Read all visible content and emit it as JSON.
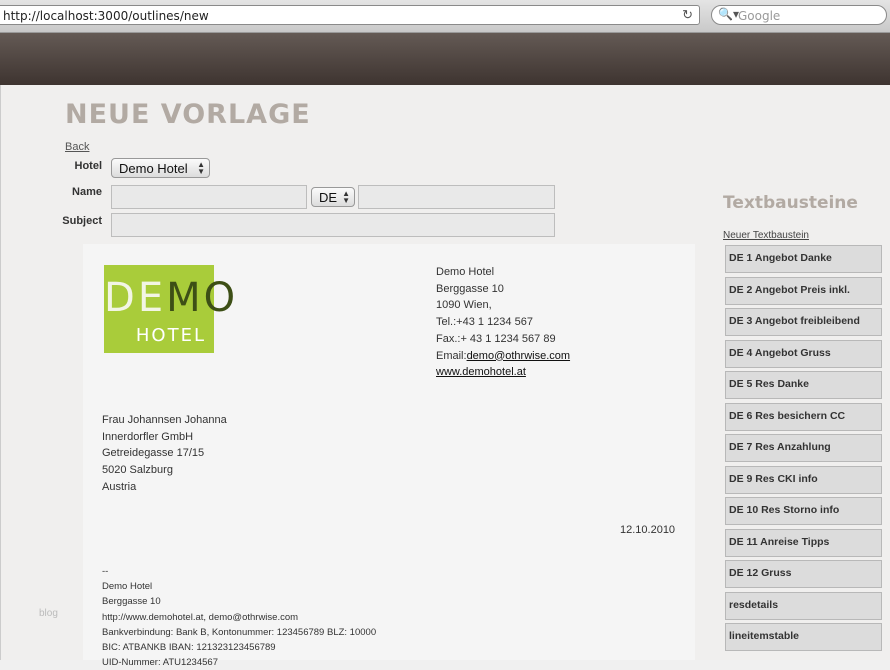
{
  "browser": {
    "url": "http://localhost:3000/outlines/new",
    "search_placeholder": "Google",
    "reload_glyph": "↻",
    "search_glyph": "🔍▾"
  },
  "page": {
    "title": "NEUE VORLAGE",
    "back": "Back"
  },
  "form": {
    "hotel_label": "Hotel",
    "hotel_value": "Demo Hotel",
    "name_label": "Name",
    "language_value": "DE",
    "subject_label": "Subject",
    "name_value": "",
    "name_suffix_value": "",
    "subject_value": ""
  },
  "letter": {
    "logo": {
      "demo_text": "DEMO",
      "hotel_text": "HOTEL"
    },
    "sender": {
      "name": "Demo Hotel",
      "street": "Berggasse 10",
      "city": "1090 Wien,",
      "tel": "Tel.:+43 1 1234 567",
      "fax": "Fax.:+ 43 1 1234 567 89",
      "email_prefix": "Email:",
      "email": "demo@othrwise.com",
      "web": "www.demohotel.at"
    },
    "recipient": [
      "Frau Johannsen Johanna",
      "Innerdorfler GmbH",
      "Getreidegasse 17/15",
      "5020 Salzburg",
      "Austria"
    ],
    "date": "12.10.2010",
    "signature": [
      "--",
      "Demo Hotel",
      "Berggasse 10",
      "http://www.demohotel.at, demo@othrwise.com",
      "Bankverbindung: Bank B, Kontonummer: 123456789 BLZ: 10000",
      "BIC: ATBANKB IBAN: 121323123456789",
      "UID-Nummer: ATU1234567"
    ]
  },
  "footer": {
    "blog": "blog"
  },
  "sidebar": {
    "title": "Textbausteine",
    "new_link": "Neuer Textbaustein",
    "items": [
      "DE 1 Angebot Danke",
      "DE 2 Angebot Preis inkl.",
      "DE 3 Angebot freibleibend",
      "DE 4 Angebot Gruss",
      "DE 5 Res Danke",
      "DE 6 Res besichern CC",
      "DE 7 Res Anzahlung",
      "DE 9 Res CKI info",
      "DE 10 Res Storno info",
      "DE 11 Anreise Tipps",
      "DE 12 Gruss",
      "resdetails",
      "lineitemstable"
    ]
  },
  "colors": {
    "header_dark": "#3e3430",
    "title_gray": "#b2aaa3",
    "logo_green": "#a9cc3a",
    "logo_dark_green": "#3d4f16"
  }
}
